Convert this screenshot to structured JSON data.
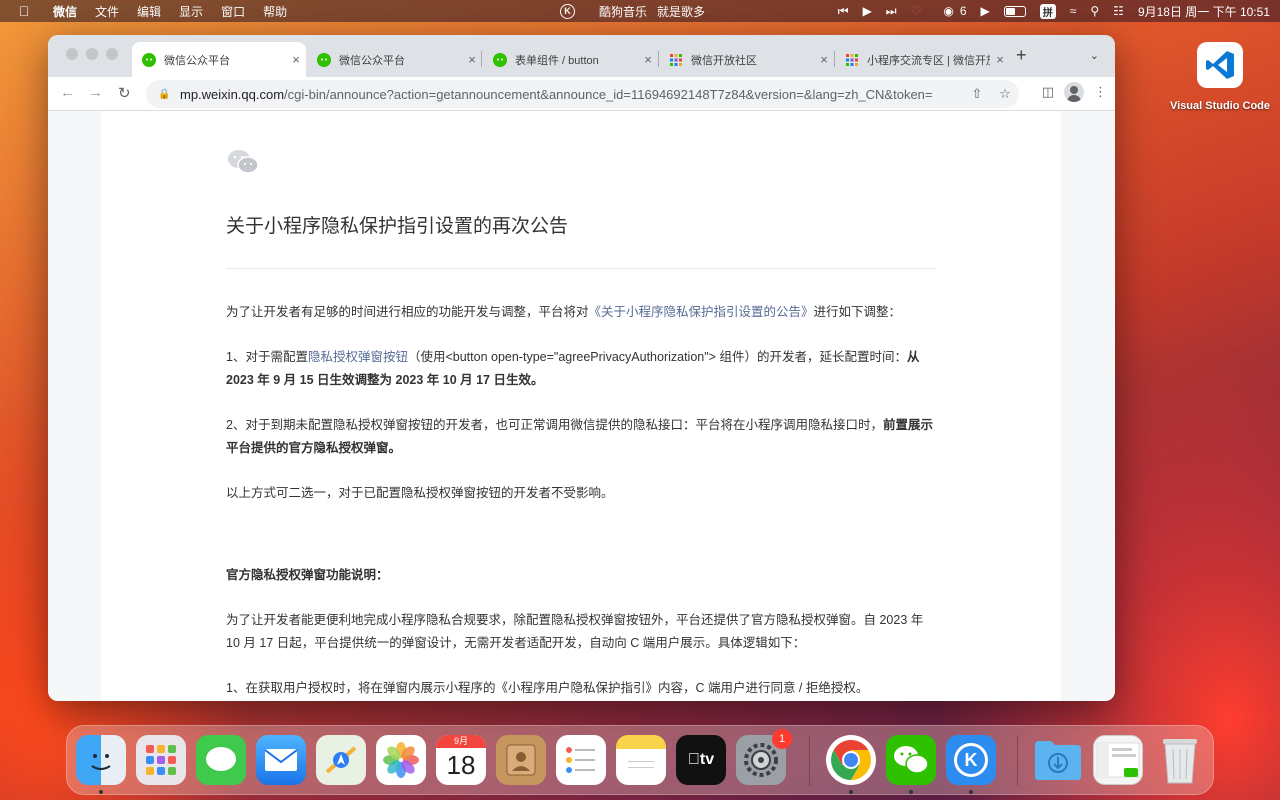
{
  "menubar": {
    "apple": "",
    "items": [
      "微信",
      "文件",
      "编辑",
      "显示",
      "窗口",
      "帮助"
    ],
    "music_app": "酷狗音乐",
    "song": "就是歌多",
    "wechat_count": "6",
    "ime": "拼",
    "datetime": "9月18日 周一 下午 10:51"
  },
  "desktop": {
    "vscode_label": "Visual Studio Code"
  },
  "browser": {
    "tabs": [
      {
        "title": "微信公众平台",
        "close": "×"
      },
      {
        "title": "微信公众平台",
        "close": "×"
      },
      {
        "title": "表单组件 / button",
        "close": "×"
      },
      {
        "title": "微信开放社区",
        "close": "×"
      },
      {
        "title": "小程序交流专区 | 微信开放",
        "close": "×"
      }
    ],
    "new_tab": "+",
    "url_host": "mp.weixin.qq.com",
    "url_path": "/cgi-bin/announce?action=getannouncement&announce_id=11694692148T7z84&version=&lang=zh_CN&token="
  },
  "article": {
    "title": "关于小程序隐私保护指引设置的再次公告",
    "p1_prefix": "为了让开发者有足够的时间进行相应的功能开发与调整，平台将对",
    "p1_link": "《关于小程序隐私保护指引设置的公告》",
    "p1_suffix": "进行如下调整：",
    "p2_prefix": "1、对于需配置",
    "p2_link": "隐私授权弹窗按钮",
    "p2_mid": "（使用<button open-type=\"agreePrivacyAuthorization\"> 组件）的开发者，延长配置时间：",
    "p2_bold": "从 2023 年 9 月 15 日生效调整为 2023 年 10 月 17 日生效。",
    "p3_prefix": "2、对于到期未配置隐私授权弹窗按钮的开发者，也可正常调用微信提供的隐私接口：平台将在小程序调用隐私接口时，",
    "p3_bold": "前置展示平台提供的官方隐私授权弹窗。",
    "p4": "以上方式可二选一，对于已配置隐私授权弹窗按钮的开发者不受影响。",
    "section_heading": "官方隐私授权弹窗功能说明：",
    "p5": "为了让开发者能更便利地完成小程序隐私合规要求，除配置隐私授权弹窗按钮外，平台还提供了官方隐私授权弹窗。自 2023 年 10 月 17 日起，平台提供统一的弹窗设计，无需开发者适配开发，自动向 C 端用户展示。具体逻辑如下：",
    "p6": "1、在获取用户授权时，将在弹窗内展示小程序的《小程序用户隐私保护指引》内容，C 端用户进行同意 / 拒绝授权。"
  },
  "dock": {
    "calendar_month": "9月",
    "calendar_day": "18",
    "settings_badge": "1",
    "tv_label": "tv"
  }
}
